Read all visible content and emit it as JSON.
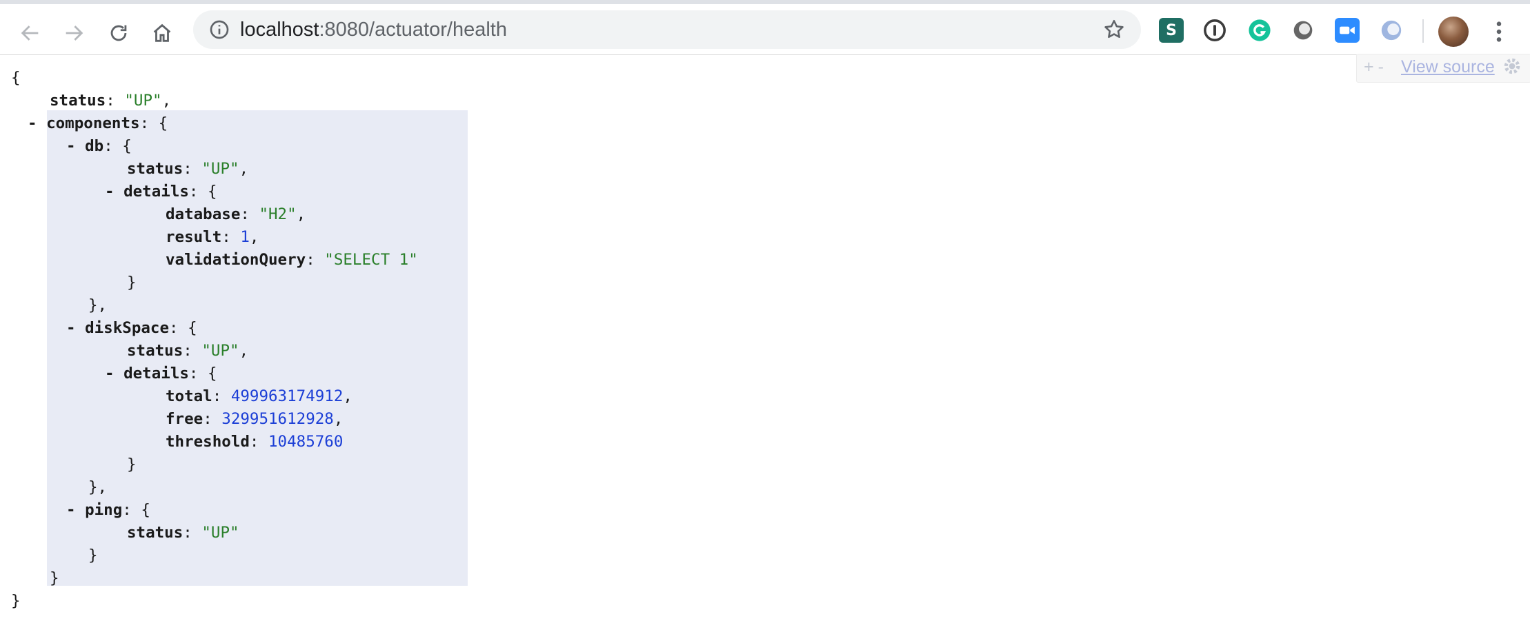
{
  "browser": {
    "url_host": "localhost",
    "url_path": ":8080/actuator/health",
    "back_label": "Back",
    "forward_label": "Forward",
    "reload_label": "Reload",
    "home_label": "Home",
    "bookmark_label": "Bookmark this tab",
    "extensions": [
      "stylus-icon",
      "1password-icon",
      "grammarly-icon",
      "generic-extension-icon",
      "zoom-icon",
      "lighthouse-icon"
    ]
  },
  "viewer": {
    "expand_label": "+",
    "collapse_label": "-",
    "view_source_label": "View source"
  },
  "json": {
    "open_brace": "{",
    "close_brace": "}",
    "toggle": "-",
    "status_key": "status",
    "status_value": "\"UP\"",
    "components_key": "components",
    "db_key": "db",
    "db_status_value": "\"UP\"",
    "details_key": "details",
    "database_key": "database",
    "database_value": "\"H2\"",
    "result_key": "result",
    "result_value": "1",
    "validation_key": "validationQuery",
    "validation_value": "\"SELECT 1\"",
    "diskspace_key": "diskSpace",
    "diskspace_status_value": "\"UP\"",
    "total_key": "total",
    "total_value": "499963174912",
    "free_key": "free",
    "free_value": "329951612928",
    "threshold_key": "threshold",
    "threshold_value": "10485760",
    "ping_key": "ping",
    "ping_status_value": "\"UP\""
  },
  "colors": {
    "string": "#2a7f2a",
    "number": "#1c3fd6",
    "highlight": "#e8ebf5"
  }
}
